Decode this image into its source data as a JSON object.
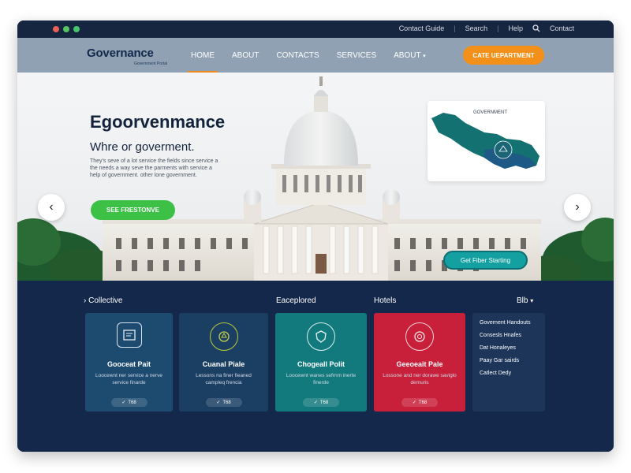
{
  "topbar": {
    "links": [
      "Contact Guide",
      "Search",
      "Help",
      "Contact"
    ]
  },
  "brand": {
    "title": "Governance",
    "subtitle": "Government Portal"
  },
  "nav": {
    "items": [
      "HOME",
      "ABOUT",
      "CONTACTS",
      "SERVICES",
      "ABOUT"
    ],
    "cta_label": "CATE UEPARTMENT"
  },
  "hero": {
    "title": "Egoorvenmance",
    "subtitle": "Whre or goverment.",
    "body": "They's seve of a lot service the fields since service a the needs a way seve the parments with service a help of government. other lone government.",
    "button_label": "SEE FRESTONVE",
    "map_label": "GOVERNMENT",
    "pill_label": "Get Fiber Starting"
  },
  "sections": {
    "left": "Collective",
    "middle": "Eaceplored",
    "right": "Hotels",
    "menu": "Blb"
  },
  "cards": [
    {
      "title": "Gooceat Pait",
      "body": "Loocewnt ner service a nerve service finarde",
      "foot": "T68"
    },
    {
      "title": "Cuanal Piale",
      "body": "Lessons na finer fieaned campleq frencia",
      "foot": "T68"
    },
    {
      "title": "Chogeall Polit",
      "body": "Loocewnt wanes sefrnm inerte finerde",
      "foot": "T68"
    },
    {
      "title": "Geeoeait Pale",
      "body": "Lossone and ner dorawe saviglo demuris",
      "foot": "T68"
    }
  ],
  "side_list": [
    "Governent Handouts",
    "Consesls Hnafes",
    "Dat Honaleyes",
    "Paay Gar sairds",
    "Catlect Dedy"
  ],
  "colors": {
    "navy": "#13284a",
    "accent_orange": "#f39019",
    "accent_green": "#3cc146",
    "card_blue": "#1c4a6e",
    "card_teal": "#127a7c",
    "card_red": "#c8203a"
  }
}
